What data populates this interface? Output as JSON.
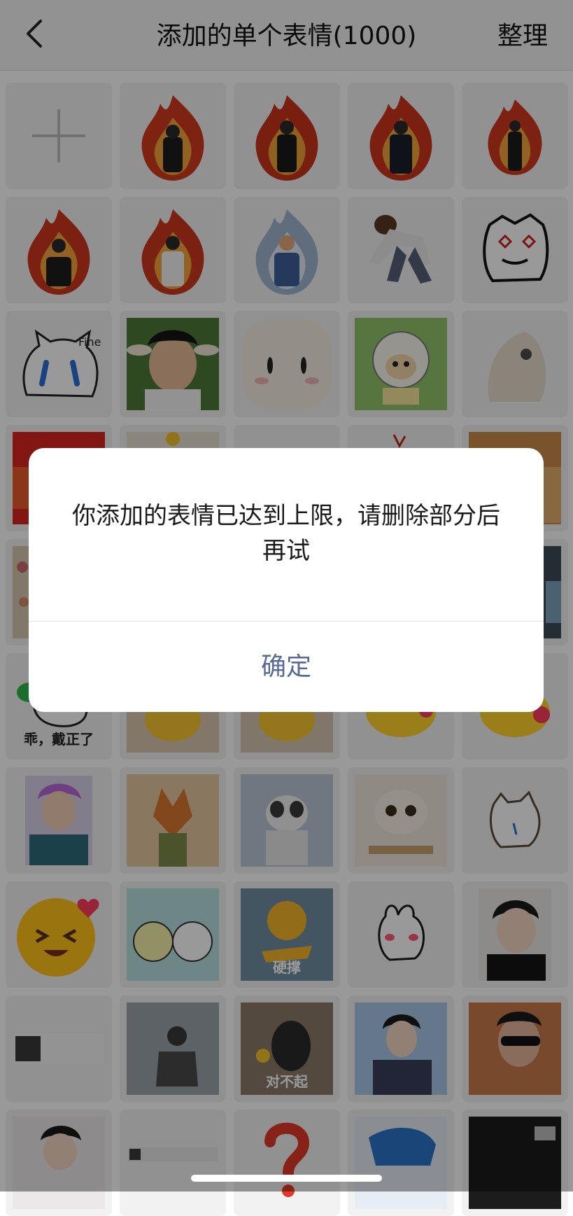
{
  "header": {
    "title": "添加的单个表情(1000)",
    "right_action": "整理",
    "back_icon": "chevron-left-icon"
  },
  "grid": {
    "add_tile_icon": "plus-icon",
    "sticker_captions": {
      "bunny_bowing": "乖，戴正了",
      "dog_hold_on": "硬撑",
      "dog_sorry": "对不起"
    }
  },
  "dialog": {
    "message": "你添加的表情已达到上限，请删除部分后再试",
    "confirm_label": "确定"
  },
  "colors": {
    "dialog_button": "#576b95",
    "overlay": "rgba(0,0,0,0.40)",
    "header_bg": "#f4f4f4"
  }
}
